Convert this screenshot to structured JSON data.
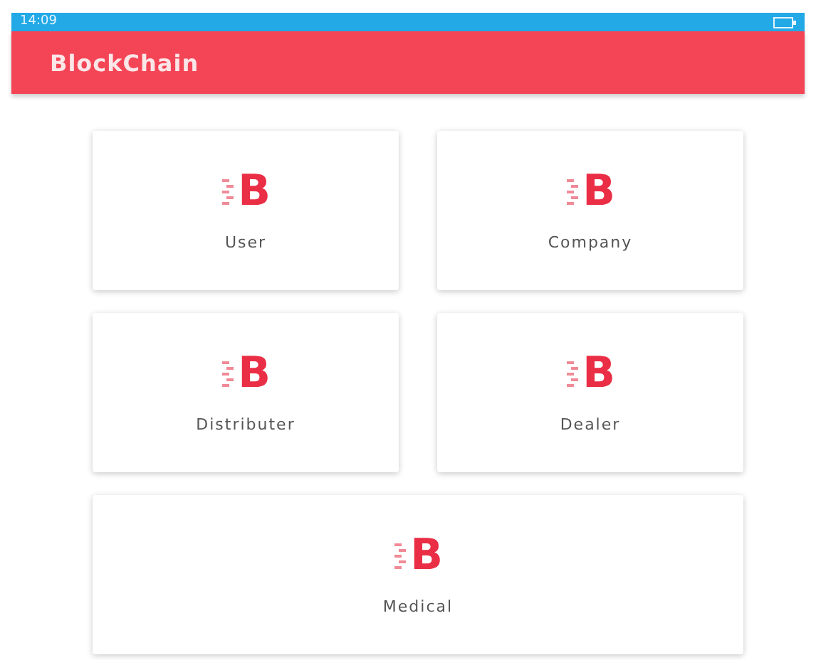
{
  "status_bar": {
    "time": "14:09"
  },
  "app_bar": {
    "title": "BlockChain"
  },
  "cards": [
    {
      "label": "User",
      "logo": "B"
    },
    {
      "label": "Company",
      "logo": "B"
    },
    {
      "label": "Distributer",
      "logo": "B"
    },
    {
      "label": "Dealer",
      "logo": "B"
    },
    {
      "label": "Medical",
      "logo": "B"
    }
  ]
}
